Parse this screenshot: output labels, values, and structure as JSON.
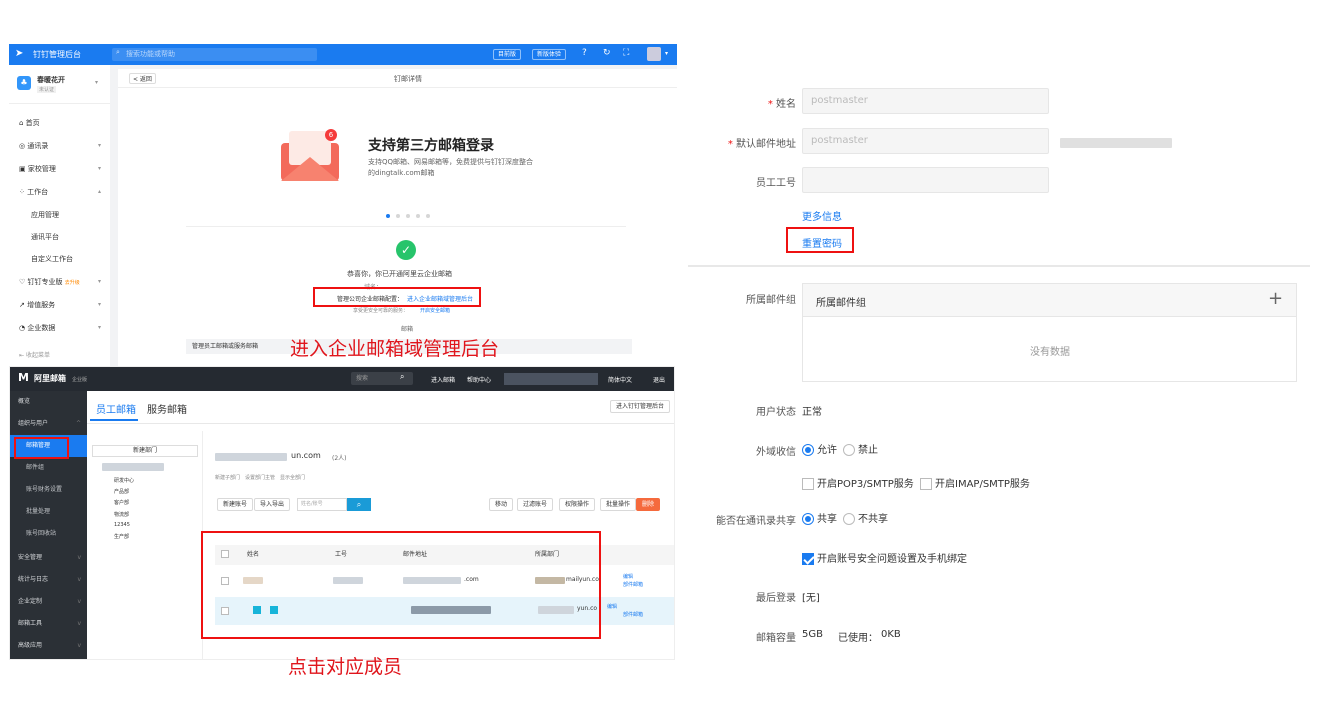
{
  "panel1": {
    "app_title": "钉钉管理后台",
    "search_placeholder": "搜索功能或帮助",
    "top_btn1": "目前版",
    "top_btn2": "新版体验",
    "org_name": "春暖花开",
    "org_sub": "未认证",
    "nav": [
      {
        "label": "首页"
      },
      {
        "label": "通讯录"
      },
      {
        "label": "家校管理"
      },
      {
        "label": "工作台"
      },
      {
        "label": "应用管理"
      },
      {
        "label": "通讯平台"
      },
      {
        "label": "自定义工作台"
      },
      {
        "label": "钉钉专业版"
      },
      {
        "label": "增值服务"
      },
      {
        "label": "企业数据"
      },
      {
        "label": "收起菜单"
      }
    ],
    "pro_badge": "去升级",
    "back_btn": "< 返回",
    "page_title": "钉邮详情",
    "banner_title": "支持第三方邮箱登录",
    "banner_desc1": "支持QQ邮箱、网易邮箱等，免费提供与钉钉深度整合",
    "banner_desc2": "的dingtalk.com邮箱",
    "badge_count": "6",
    "success_text": "恭喜你，你已开通阿里云企业邮箱",
    "domain_line": "域名：",
    "config_label": "管理公司企业邮箱配置：",
    "config_link": "进入企业邮箱域管理后台",
    "safety_line": "享受更安全可靠的服务：",
    "safety_link": "开启安全邮箱",
    "section_label": "邮箱",
    "bottom_row": "管理员工邮箱或服务邮箱"
  },
  "annotation1": "进入企业邮箱域管理后台",
  "annotation2": "点击对应成员",
  "panel2": {
    "logo": "阿里邮箱",
    "logo_sub": "企业版",
    "search_placeholder": "搜索",
    "top_links": [
      "进入邮箱",
      "帮助中心"
    ],
    "lang": "简体中文",
    "logout": "退出",
    "nav": [
      {
        "label": "概览"
      },
      {
        "label": "组织与用户"
      },
      {
        "label": "邮箱管理"
      },
      {
        "label": "邮件组"
      },
      {
        "label": "账号财务设置"
      },
      {
        "label": "批量处理"
      },
      {
        "label": "账号回收站"
      },
      {
        "label": "安全管理"
      },
      {
        "label": "统计与日志"
      },
      {
        "label": "企业定制"
      },
      {
        "label": "邮箱工具"
      },
      {
        "label": "高级应用"
      }
    ],
    "tabs": [
      "员工邮箱",
      "服务邮箱"
    ],
    "enter_dept_btn": "进入钉钉管理后台",
    "new_dept_btn": "新建部门",
    "tree": [
      "研发中心",
      "产品部",
      "客户部",
      "物流部",
      "12345",
      "生产部"
    ],
    "domain": "un.com",
    "count": "(2人)",
    "sub_links": "新建子部门　设置部门主管　显示全部门",
    "toolbar": [
      "新建账号",
      "导入导出",
      "删除",
      "移动",
      "过滤账号",
      "权限操作",
      "批量操作",
      "删除"
    ],
    "search_ph": "姓名/账号",
    "cols": [
      "姓名",
      "工号",
      "邮件地址",
      "所属部门"
    ],
    "row1_email": ".com",
    "row1_dept": "mailyun.co",
    "row2_dept": "yun.co",
    "actions": [
      "编辑",
      "删除",
      "移动",
      "部件邮箱"
    ]
  },
  "panel3": {
    "name_label": "姓名",
    "name_value": "postmaster",
    "email_label": "默认邮件地址",
    "email_value": "postmaster",
    "empid_label": "员工工号",
    "more_info": "更多信息",
    "reset_pwd": "重置密码",
    "group_label": "所属邮件组",
    "group_header": "所属邮件组",
    "group_empty": "没有数据",
    "status_label": "用户状态",
    "status_value": "正常",
    "ext_label": "外域收信",
    "ext_allow": "允许",
    "ext_deny": "禁止",
    "pop3": "开启POP3/SMTP服务",
    "imap": "开启IMAP/SMTP服务",
    "share_label": "能否在通讯录共享",
    "share_yes": "共享",
    "share_no": "不共享",
    "security": "开启账号安全问题设置及手机绑定",
    "last_login_label": "最后登录",
    "last_login_value": "[无]",
    "capacity_label": "邮箱容量",
    "capacity_value": "5GB",
    "used_label": "已使用：",
    "used_value": "0KB"
  }
}
